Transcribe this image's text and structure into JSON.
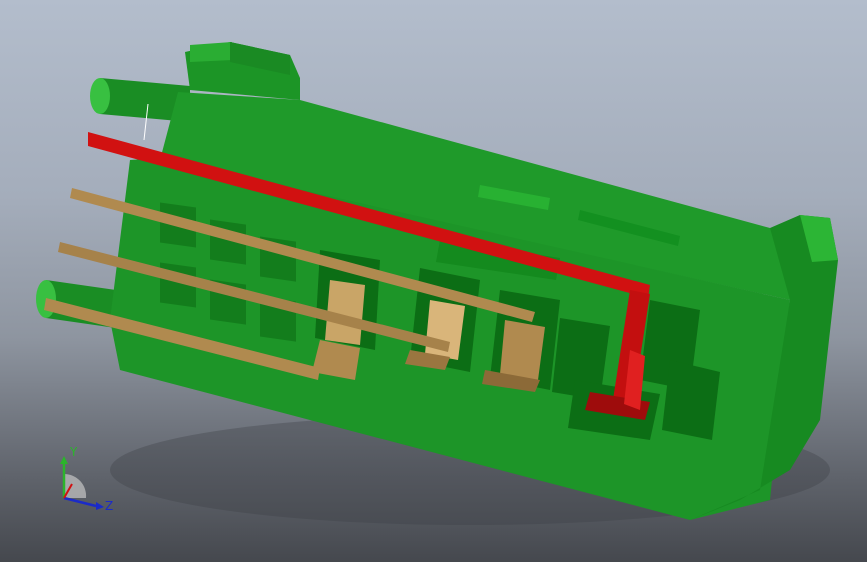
{
  "viewport": {
    "colors": {
      "housing": "#1f9a2a",
      "housing_dark": "#0e6b16",
      "housing_light": "#38c041",
      "terminal_red": "#d11111",
      "terminal_red_dark": "#8e0c0c",
      "pin_tan": "#b08a4f",
      "pin_tan_light": "#d9b57a"
    }
  },
  "triad": {
    "y_label": "Y",
    "z_label": "Z",
    "y_color": "#2bb52b",
    "z_color": "#1b2bc8"
  }
}
